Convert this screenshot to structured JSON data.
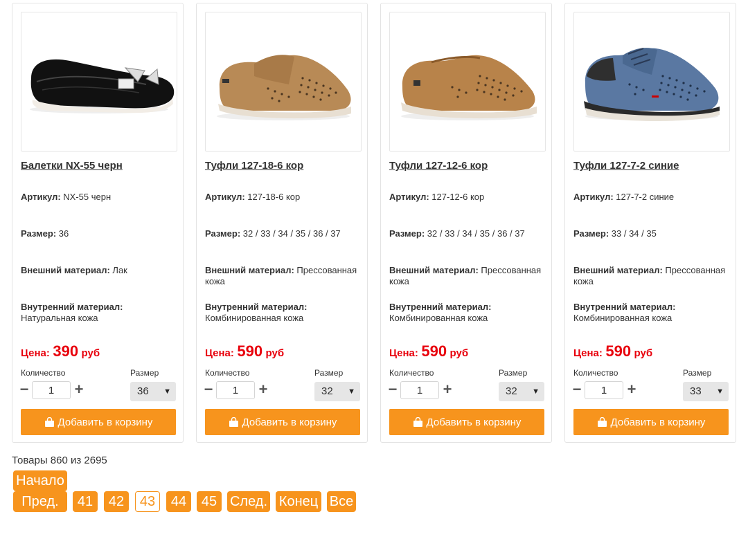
{
  "labels": {
    "article": "Артикул:",
    "size": "Размер:",
    "outer": "Внешний материал:",
    "inner": "Внутренний материал:",
    "price": "Цена:",
    "currency": "руб",
    "quantity": "Количество",
    "size_select": "Размер",
    "add_to_cart": "Добавить в корзину"
  },
  "products": [
    {
      "name": "Балетки NX-55 черн",
      "article": "NX-55 черн",
      "sizes": "36",
      "outer": "Лак",
      "inner": "Натуральная кожа",
      "price": "390",
      "qty": "1",
      "selected_size": "36",
      "image": "black-ballet-flat-with-bow"
    },
    {
      "name": "Туфли 127-18-6 кор",
      "article": "127-18-6 кор",
      "sizes": "32 / 33 / 34 / 35 / 36 / 37",
      "outer": "Прессованная кожа",
      "inner": "Комбинированная кожа",
      "price": "590",
      "qty": "1",
      "selected_size": "32",
      "image": "brown-perforated-velcro-shoe"
    },
    {
      "name": "Туфли 127-12-6 кор",
      "article": "127-12-6 кор",
      "sizes": "32 / 33 / 34 / 35 / 36 / 37",
      "outer": "Прессованная кожа",
      "inner": "Комбинированная кожа",
      "price": "590",
      "qty": "1",
      "selected_size": "32",
      "image": "brown-perforated-slip-on-shoe"
    },
    {
      "name": "Туфли 127-7-2 синие",
      "article": "127-7-2 синие",
      "sizes": "33 / 34 / 35",
      "outer": "Прессованная кожа",
      "inner": "Комбинированная кожа",
      "price": "590",
      "qty": "1",
      "selected_size": "33",
      "image": "blue-perforated-lace-up-shoe"
    }
  ],
  "pagination": {
    "summary": "Товары 860 из 2695",
    "start": "Начало",
    "prev": "Пред.",
    "pages": [
      "41",
      "42",
      "43",
      "44",
      "45"
    ],
    "current": "43",
    "next": "След.",
    "end": "Конец",
    "all": "Все"
  },
  "colors": {
    "accent": "#f7941d",
    "price": "#e8000c"
  }
}
